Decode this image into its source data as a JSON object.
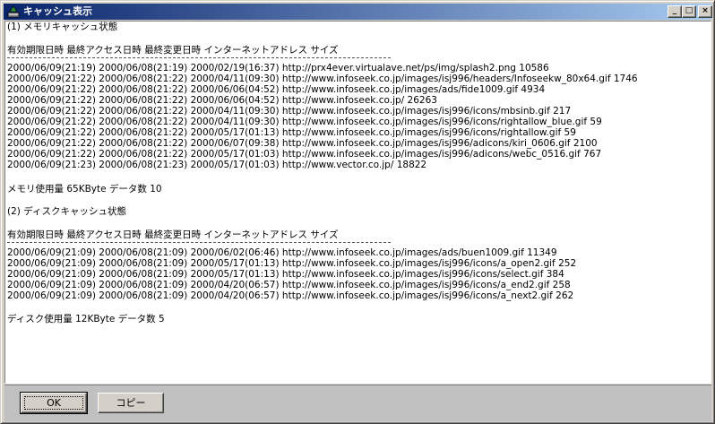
{
  "window": {
    "title": "キャッシュ表示",
    "controls": {
      "minimize": "_",
      "maximize": "□",
      "close": "×"
    }
  },
  "memory": {
    "heading": "(1) メモリキャッシュ状態",
    "columns": "有効期限日時 最終アクセス日時 最終変更日時 インターネットアドレス サイズ",
    "rows": [
      "2000/06/09(21:19) 2000/06/08(21:19) 2000/02/19(16:37) http://prx4ever.virtualave.net/ps/img/splash2.png 10586",
      "2000/06/09(21:22) 2000/06/08(21:22) 2000/04/11(09:30) http://www.infoseek.co.jp/images/isj996/headers/Infoseekw_80x64.gif 1746",
      "2000/06/09(21:22) 2000/06/08(21:22) 2000/06/06(04:52) http://www.infoseek.co.jp/images/ads/fide1009.gif 4934",
      "2000/06/09(21:22) 2000/06/08(21:22) 2000/06/06(04:52) http://www.infoseek.co.jp/ 26263",
      "2000/06/09(21:22) 2000/06/08(21:22) 2000/04/11(09:30) http://www.infoseek.co.jp/images/isj996/icons/mbsinb.gif 217",
      "2000/06/09(21:22) 2000/06/08(21:22) 2000/04/11(09:30) http://www.infoseek.co.jp/images/isj996/icons/rightallow_blue.gif 59",
      "2000/06/09(21:22) 2000/06/08(21:22) 2000/05/17(01:13) http://www.infoseek.co.jp/images/isj996/icons/rightallow.gif 59",
      "2000/06/09(21:22) 2000/06/08(21:22) 2000/06/07(09:38) http://www.infoseek.co.jp/images/isj996/adicons/kiri_0606.gif 2100",
      "2000/06/09(21:22) 2000/06/08(21:22) 2000/05/17(01:03) http://www.infoseek.co.jp/images/isj996/adicons/webc_0516.gif 767",
      "2000/06/09(21:23) 2000/06/08(21:23) 2000/05/17(01:03) http://www.vector.co.jp/ 18822"
    ],
    "summary": "メモリ使用量 65KByte データ数 10"
  },
  "disk": {
    "heading": "(2) ディスクキャッシュ状態",
    "columns": "有効期限日時 最終アクセス日時 最終変更日時 インターネットアドレス サイズ",
    "rows": [
      "2000/06/09(21:09) 2000/06/08(21:09) 2000/06/02(06:46) http://www.infoseek.co.jp/images/ads/buen1009.gif 11349",
      "2000/06/09(21:09) 2000/06/08(21:09) 2000/05/17(01:13) http://www.infoseek.co.jp/images/isj996/icons/a_open2.gif 252",
      "2000/06/09(21:09) 2000/06/08(21:09) 2000/05/17(01:13) http://www.infoseek.co.jp/images/isj996/icons/select.gif 384",
      "2000/06/09(21:09) 2000/06/08(21:09) 2000/04/20(06:57) http://www.infoseek.co.jp/images/isj996/icons/a_end2.gif 258",
      "2000/06/09(21:09) 2000/06/08(21:09) 2000/04/20(06:57) http://www.infoseek.co.jp/images/isj996/icons/a_next2.gif 262"
    ],
    "summary": "ディスク使用量 12KByte データ数 5"
  },
  "buttons": {
    "ok": "OK",
    "copy": "コピー"
  }
}
